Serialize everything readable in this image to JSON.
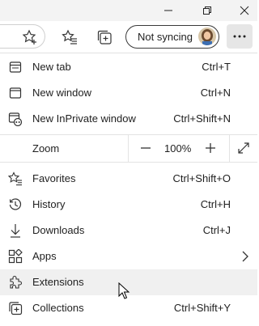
{
  "profile": {
    "label": "Not syncing"
  },
  "zoom": {
    "label": "Zoom",
    "value": "100%"
  },
  "menu": {
    "items": [
      {
        "id": "new-tab",
        "label": "New tab",
        "shortcut": "Ctrl+T"
      },
      {
        "id": "new-window",
        "label": "New window",
        "shortcut": "Ctrl+N"
      },
      {
        "id": "new-inprivate",
        "label": "New InPrivate window",
        "shortcut": "Ctrl+Shift+N"
      },
      {
        "id": "favorites",
        "label": "Favorites",
        "shortcut": "Ctrl+Shift+O"
      },
      {
        "id": "history",
        "label": "History",
        "shortcut": "Ctrl+H"
      },
      {
        "id": "downloads",
        "label": "Downloads",
        "shortcut": "Ctrl+J"
      },
      {
        "id": "apps",
        "label": "Apps",
        "shortcut": ""
      },
      {
        "id": "extensions",
        "label": "Extensions",
        "shortcut": ""
      },
      {
        "id": "collections",
        "label": "Collections",
        "shortcut": "Ctrl+Shift+Y"
      }
    ]
  },
  "colors": {
    "hover_bg": "#f0f0f0",
    "titlebar_bg": "#f3f3f3",
    "more_btn_bg": "#e6e6e6"
  }
}
